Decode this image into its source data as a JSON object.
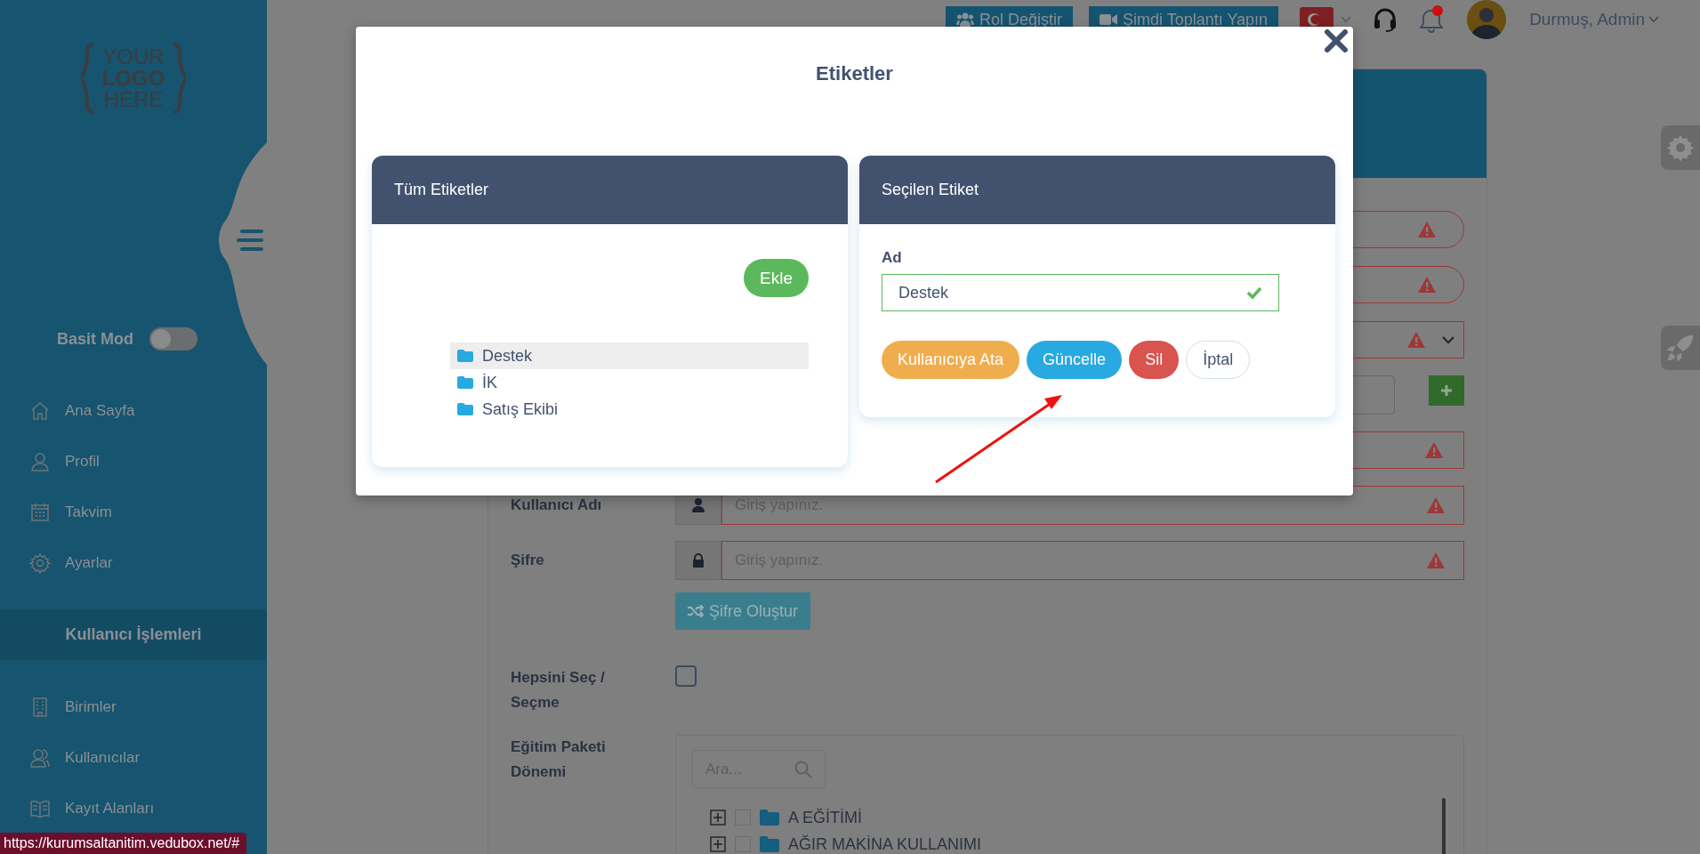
{
  "topbar": {
    "buttons": [
      {
        "label": "Rol Değiştir"
      },
      {
        "label": "Şimdi Toplantı Yapın"
      }
    ],
    "user_name": "Durmuş, Admin"
  },
  "sidebar": {
    "logo_lines": [
      "YOUR",
      "LOGO",
      "HERE"
    ],
    "simple_mode": {
      "label": "Basit Mod",
      "on": false
    },
    "items": [
      {
        "label": "Ana Sayfa"
      },
      {
        "label": "Profil"
      },
      {
        "label": "Takvim"
      },
      {
        "label": "Ayarlar"
      }
    ],
    "section": "Kullanıcı İşlemleri",
    "section_items": [
      {
        "label": "Birimler"
      },
      {
        "label": "Kullanıcılar"
      },
      {
        "label": "Kayıt Alanları"
      }
    ]
  },
  "form": {
    "upper_fields": [
      {
        "kind": "pill",
        "invalid": true
      },
      {
        "kind": "pill",
        "invalid": true
      },
      {
        "kind": "select",
        "invalid": true
      },
      {
        "kind": "add",
        "invalid": false
      },
      {
        "kind": "text",
        "invalid": true
      }
    ],
    "fields": [
      {
        "label": "Kullanıcı Adı",
        "placeholder": "Giriş yapınız.",
        "invalid": true
      },
      {
        "label": "Şifre",
        "placeholder": "Giriş yapınız.",
        "invalid": true
      }
    ],
    "generate_button": "Şifre Oluştur",
    "select_all": {
      "label": "Hepsini Seç / Seçme",
      "checked": false
    },
    "package": {
      "label": "Eğitim Paketi Dönemi",
      "search_placeholder": "Ara...",
      "items": [
        {
          "label": "A EĞİTİMİ",
          "checked": false,
          "expanded": false
        },
        {
          "label": "AĞIR MAKİNA KULLANIMI",
          "checked": false,
          "expanded": false
        }
      ]
    }
  },
  "modal": {
    "title": "Etiketler",
    "left": {
      "title": "Tüm Etiketler",
      "add_button": "Ekle",
      "tags": [
        {
          "label": "Destek",
          "selected": true
        },
        {
          "label": "İK",
          "selected": false
        },
        {
          "label": "Satış Ekibi",
          "selected": false
        }
      ]
    },
    "right": {
      "title": "Seçilen Etiket",
      "field_label": "Ad",
      "value": "Destek",
      "valid": true,
      "buttons": [
        {
          "label": "Kullanıcıya Ata",
          "kind": "warning"
        },
        {
          "label": "Güncelle",
          "kind": "info"
        },
        {
          "label": "Sil",
          "kind": "danger"
        },
        {
          "label": "İptal",
          "kind": "outline"
        }
      ]
    }
  },
  "status_bar": {
    "url": "https://kurumsaltanitim.vedubox.net/#"
  }
}
